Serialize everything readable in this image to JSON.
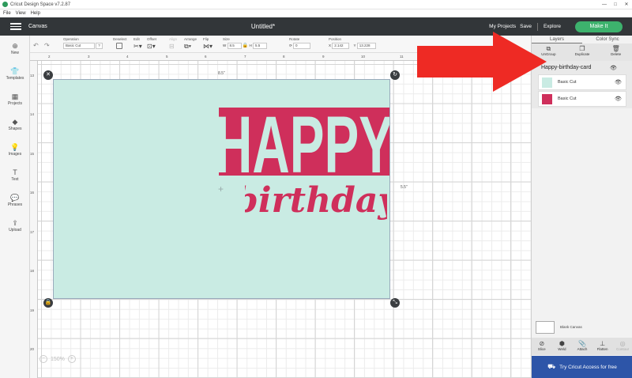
{
  "titlebar": {
    "title": "Cricut Design Space v7.2.87",
    "min": "—",
    "max": "□",
    "close": "✕"
  },
  "menubar": {
    "items": [
      "File",
      "View",
      "Help"
    ]
  },
  "header": {
    "canvas_label": "Canvas",
    "doc_title": "Untitled*",
    "my_projects": "My Projects",
    "save": "Save",
    "explore": "Explore",
    "make_it": "Make It"
  },
  "toolbar": {
    "operation_label": "Operation",
    "operation_value": "Basic Cut",
    "deselect_label": "Deselect",
    "edit_label": "Edit",
    "offset_label": "Offset",
    "align_label": "Align",
    "arrange_label": "Arrange",
    "flip_label": "Flip",
    "size_label": "Size",
    "w_label": "W",
    "w_value": "8.5",
    "h_label": "H",
    "h_value": "5.5",
    "rotate_label": "Rotate",
    "rotate_value": "0",
    "position_label": "Position",
    "x_label": "X",
    "x_value": "2.142",
    "y_label": "Y",
    "y_value": "13.228"
  },
  "sidebar": {
    "items": [
      {
        "label": "New",
        "icon": "plus-circle-icon",
        "glyph": "⊕"
      },
      {
        "label": "Templates",
        "icon": "shirt-icon",
        "glyph": "👕"
      },
      {
        "label": "Projects",
        "icon": "projects-icon",
        "glyph": "▦"
      },
      {
        "label": "Shapes",
        "icon": "shapes-icon",
        "glyph": "◆"
      },
      {
        "label": "Images",
        "icon": "lightbulb-icon",
        "glyph": "💡"
      },
      {
        "label": "Text",
        "icon": "text-icon",
        "glyph": "T"
      },
      {
        "label": "Phrases",
        "icon": "speech-bubble-icon",
        "glyph": "💬"
      },
      {
        "label": "Upload",
        "icon": "upload-icon",
        "glyph": "⇪"
      }
    ]
  },
  "rulers": {
    "h": [
      "2",
      "3",
      "4",
      "5",
      "6",
      "7",
      "8",
      "9",
      "10",
      "11"
    ],
    "v": [
      "13",
      "14",
      "15",
      "16",
      "17",
      "18",
      "19",
      "20"
    ]
  },
  "canvas": {
    "width_label": "8.5\"",
    "height_label": "5.5\"",
    "headline": "HAPPY",
    "script": "birthday",
    "card_color": "#c9ebe3",
    "ink_color": "#cf2f5b"
  },
  "zoom": {
    "minus": "−",
    "value": "150%",
    "plus": "+"
  },
  "panel": {
    "tab_layers": "Layers",
    "tab_color_sync": "Color Sync",
    "actions": [
      {
        "label": "UnGroup",
        "icon": "ungroup-icon",
        "glyph": "⧉"
      },
      {
        "label": "Duplicate",
        "icon": "duplicate-icon",
        "glyph": "❐"
      },
      {
        "label": "Delete",
        "icon": "trash-icon",
        "glyph": "🗑"
      }
    ],
    "group_name": "Happy-birthday-card",
    "layers": [
      {
        "name": "Basic Cut",
        "color": "#c9ebe3"
      },
      {
        "name": "Basic Cut",
        "color": "#cf2f5b"
      }
    ],
    "blank_canvas": "Blank Canvas",
    "bottom_actions": [
      {
        "label": "Slice",
        "icon": "slice-icon",
        "glyph": "⊘"
      },
      {
        "label": "Weld",
        "icon": "weld-icon",
        "glyph": "⬢"
      },
      {
        "label": "Attach",
        "icon": "paperclip-icon",
        "glyph": "📎"
      },
      {
        "label": "Flatten",
        "icon": "flatten-icon",
        "glyph": "⊥"
      },
      {
        "label": "Contour",
        "icon": "contour-icon",
        "glyph": "◎"
      }
    ],
    "promo": "Try Cricut Access for free"
  },
  "colors": {
    "header": "#323639",
    "accent_green": "#3db26d",
    "promo_blue": "#2d55a8",
    "arrow_red": "#ee2a24"
  }
}
